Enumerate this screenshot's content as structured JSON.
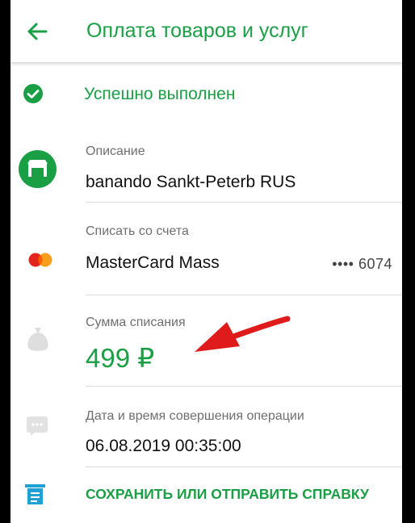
{
  "header": {
    "title": "Оплата товаров и услуг",
    "back_icon": "arrow-left-icon"
  },
  "status": {
    "text": "Успешно выполнен",
    "icon": "check-circle-icon"
  },
  "description": {
    "label": "Описание",
    "value": "banando Sankt-Peterb RUS",
    "icon": "shop-icon"
  },
  "account": {
    "label": "Списать со счета",
    "value": "MasterCard Mass",
    "card_mask": "•••• 6074",
    "icon": "mastercard-icon"
  },
  "amount": {
    "label": "Сумма списания",
    "value": "499 ₽",
    "icon": "money-bag-icon"
  },
  "datetime": {
    "label": "Дата и время совершения операции",
    "value": "06.08.2019 00:35:00",
    "icon": "chat-icon"
  },
  "action": {
    "label": "СОХРАНИТЬ ИЛИ ОТПРАВИТЬ СПРАВКУ",
    "icon": "document-icon"
  },
  "colors": {
    "accent": "#1a9f45",
    "arrow": "#e01b1b",
    "label": "#6e6e6e"
  }
}
